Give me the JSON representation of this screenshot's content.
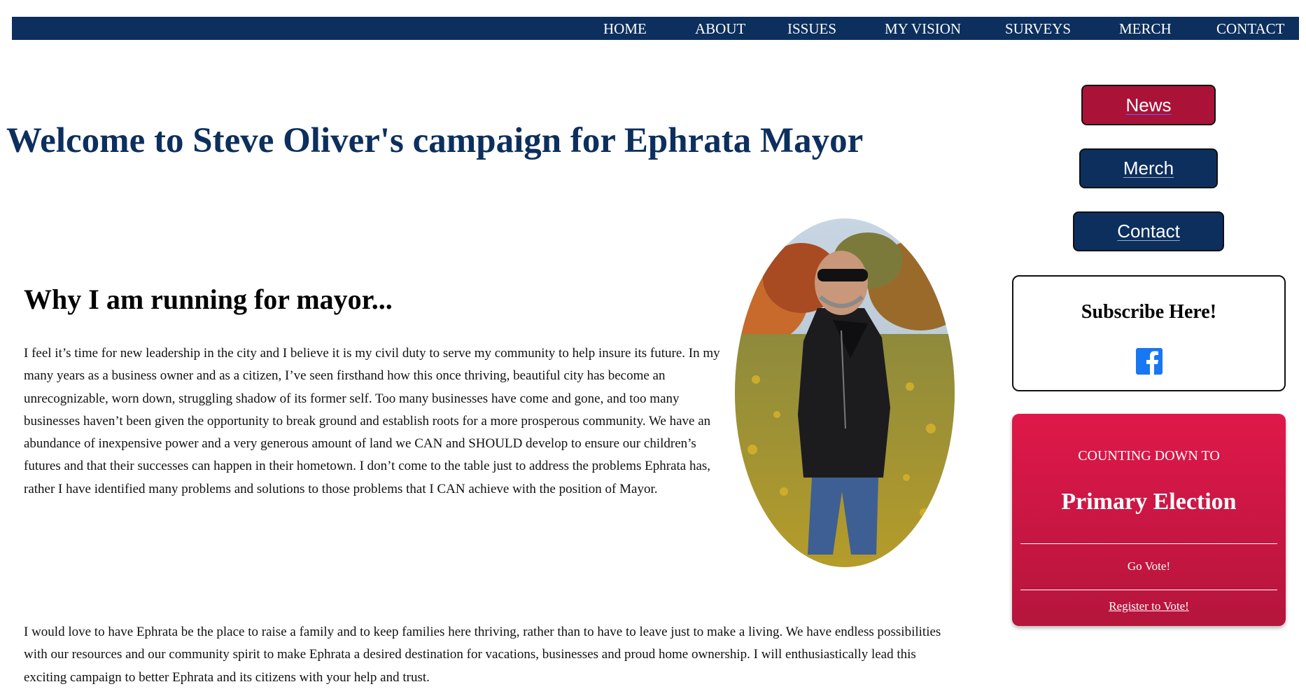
{
  "nav": {
    "items": [
      {
        "label": "HOME"
      },
      {
        "label": "ABOUT"
      },
      {
        "label": "ISSUES"
      },
      {
        "label": "MY VISION"
      },
      {
        "label": "SURVEYS"
      },
      {
        "label": "MERCH"
      },
      {
        "label": "CONTACT"
      }
    ]
  },
  "main": {
    "title": "Welcome to Steve Oliver's campaign for Ephrata Mayor",
    "heading": "Why I am running for mayor...",
    "paragraph1": "I feel it’s time for new leadership in the city and I believe it is my civil duty to serve my community to help insure its future. In my many years as a business owner and as a citizen, I’ve seen firsthand how this once thriving, beautiful city has become an unrecognizable, worn down, struggling shadow of its former self. Too many businesses have come and gone, and too many businesses haven’t been given the opportunity to break ground and establish roots for a more prosperous community. We have an abundance of inexpensive power and a very generous amount of land we CAN and SHOULD develop to ensure our children’s futures and that their successes can happen in their hometown. I don’t come to the table just to address the problems Ephrata has, rather I have identified many problems and solutions to those problems that I CAN achieve with the position of Mayor.",
    "paragraph2": "I would love to have Ephrata be the place to raise a family and to keep families here thriving, rather than to have to leave just to make a living. We have endless possibilities with our resources and our community spirit to make Ephrata a desired destination for vacations, businesses and proud home ownership. I will enthusiastically lead this exciting campaign to better Ephrata and its citizens with your help and trust."
  },
  "sidebar": {
    "buttons": {
      "news": "News",
      "merch": "Merch",
      "contact": "Contact"
    },
    "subscribe": {
      "title": "Subscribe Here!",
      "icon": "facebook-icon"
    },
    "countdown": {
      "label": "COUNTING DOWN TO",
      "event": "Primary Election",
      "go_vote": "Go Vote!",
      "register": "Register to Vote!"
    }
  },
  "colors": {
    "navy": "#0c2f5e",
    "crimson": "#ab1238",
    "countdown_top": "#df184a",
    "countdown_bottom": "#b5153c",
    "facebook": "#1877f2"
  }
}
